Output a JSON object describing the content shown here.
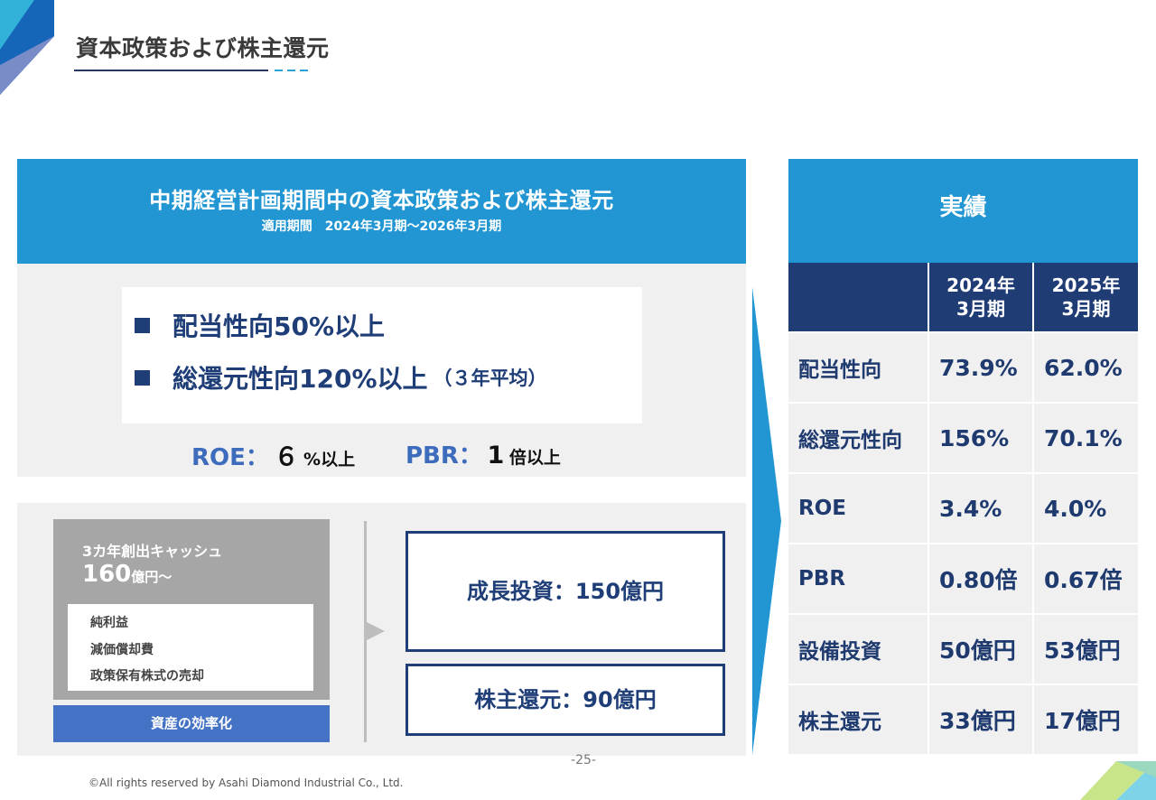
{
  "page": {
    "title": "資本政策および株主還元",
    "page_number": "-25-",
    "copyright": "©All rights reserved by Asahi Diamond Industrial Co., Ltd."
  },
  "policy": {
    "title": "中期経営計画期間中の資本政策および株主還元",
    "period": "適用期間　2024年3月期～2026年3月期",
    "targets": [
      {
        "text": "配当性向50%以上",
        "note": ""
      },
      {
        "text": "総還元性向120%以上",
        "note": "（３年平均）"
      }
    ],
    "roe_label": "ROE：",
    "roe_value": "６",
    "roe_unit": "%以上",
    "pbr_label": "PBR：",
    "pbr_value": "1",
    "pbr_unit": "倍以上"
  },
  "cash": {
    "label": "3カ年創出キャッシュ",
    "amount": "160",
    "amount_unit": "億円～",
    "sources": [
      "純利益",
      "減価償却費",
      "政策保有株式の売却"
    ],
    "efficiency": "資産の効率化",
    "growth_investment": "成長投資：150億円",
    "shareholder_return": "株主還元：90億円"
  },
  "results": {
    "title": "実績",
    "columns": [
      {
        "line1": "2024年",
        "line2": "3月期"
      },
      {
        "line1": "2025年",
        "line2": "3月期"
      }
    ],
    "rows": [
      {
        "label": "配当性向",
        "values": [
          "73.9%",
          "62.0%"
        ]
      },
      {
        "label": "総還元性向",
        "values": [
          "156%",
          "70.1%"
        ]
      },
      {
        "label": "ROE",
        "values": [
          "3.4%",
          "4.0%"
        ]
      },
      {
        "label": "PBR",
        "values": [
          "0.80倍",
          "0.67倍"
        ]
      },
      {
        "label": "設備投資",
        "values": [
          "50億円",
          "53億円"
        ]
      },
      {
        "label": "株主還元",
        "values": [
          "33億円",
          "17億円"
        ]
      }
    ]
  },
  "colors": {
    "header_blue": "#2196d3",
    "navy": "#1f3c74",
    "kpi_blue": "#3d6cbd",
    "panel_gray": "#f0f0f1"
  }
}
